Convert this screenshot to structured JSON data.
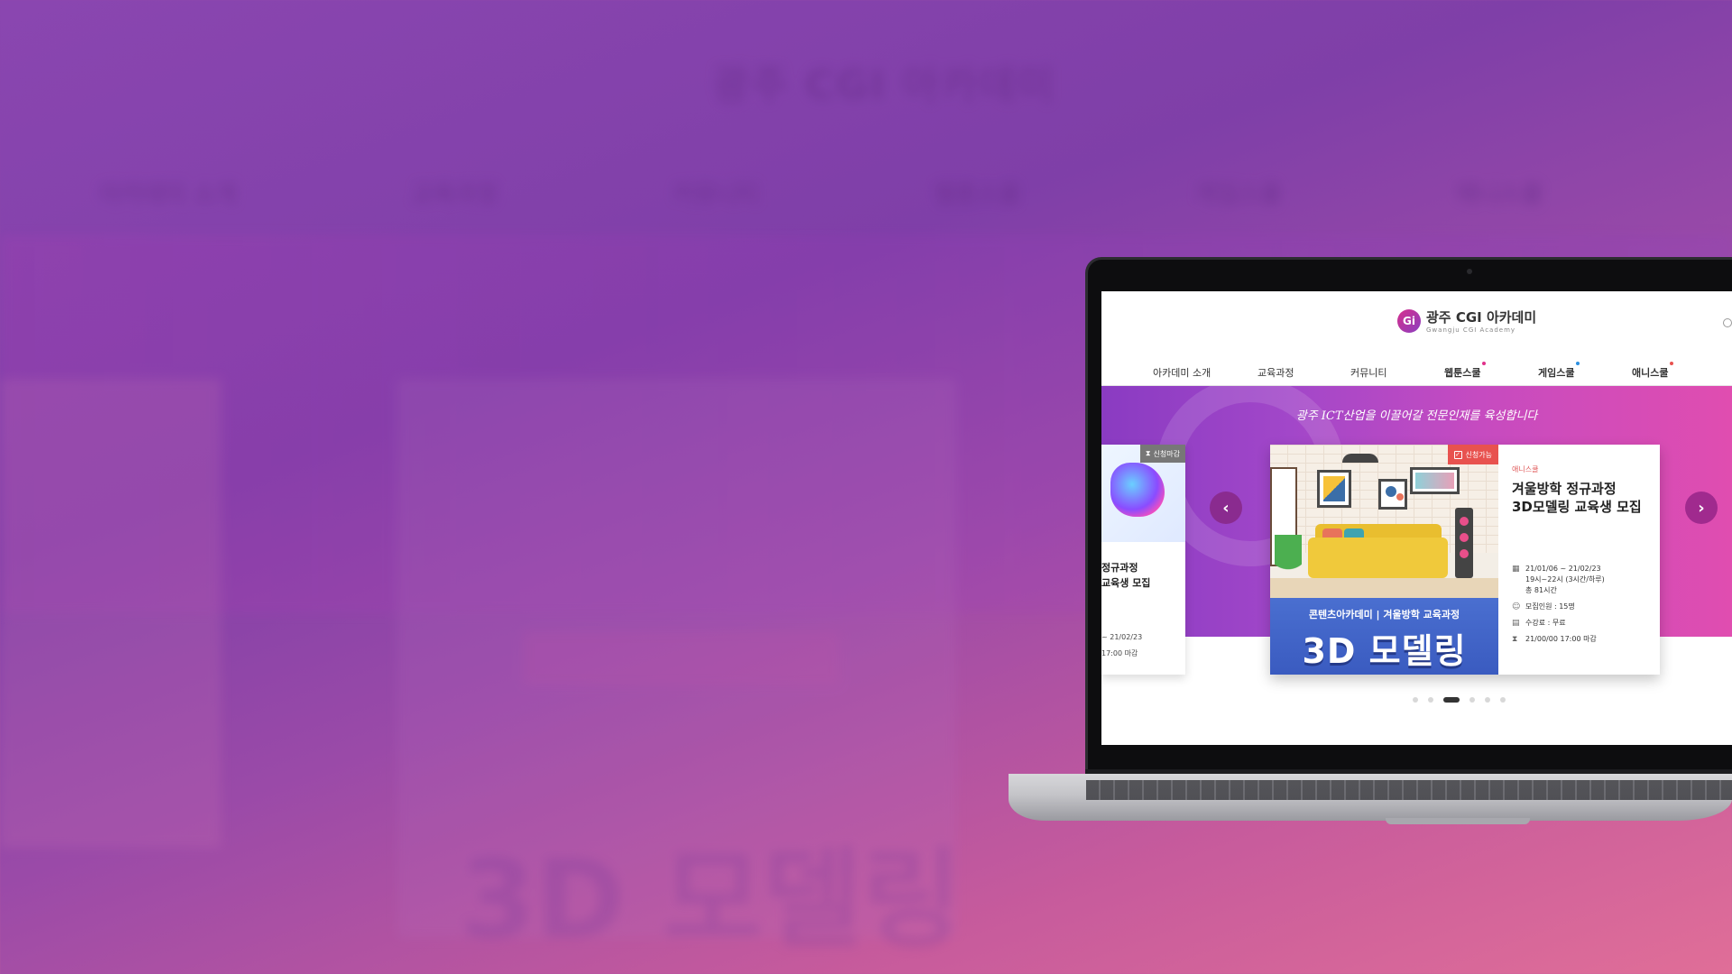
{
  "background": {
    "logo_text": "광주 CGI 아카데미",
    "nav_items": [
      "아카데미 소개",
      "교육과정",
      "커뮤니티",
      "웹툰스쿨",
      "게임스쿨",
      "애니스쿨"
    ],
    "big_text": "3D 모델링"
  },
  "site": {
    "logo_mark": "Gi",
    "logo_title": "광주 CGI 아카데미",
    "logo_sub": "Gwangju CGI Academy",
    "nav": [
      {
        "label": "아카데미 소개",
        "dot": null
      },
      {
        "label": "교육과정",
        "dot": null
      },
      {
        "label": "커뮤니티",
        "dot": null
      },
      {
        "label": "웹툰스쿨",
        "dot": "#e0308a"
      },
      {
        "label": "게임스쿨",
        "dot": "#2b8fe0"
      },
      {
        "label": "애니스쿨",
        "dot": "#e8524f"
      }
    ],
    "tagline": "광주 ICT산업을 이끌어갈 전문인재를 육성합니다"
  },
  "card_left": {
    "badge": "신청마감",
    "title_line1": "정규과정",
    "title_line2": "교육생 모집",
    "meta_line1": "~ 21/02/23",
    "meta_line2": "17:00 마감"
  },
  "card_main": {
    "badge": "신청가능",
    "banner_top": "콘텐츠아카데미 | 겨울방학 교육과정",
    "banner_big": "3D 모델링",
    "category": "애니스쿨",
    "title_line1": "겨울방학 정규과정",
    "title_line2": "3D모델링 교육생 모집",
    "rows": [
      {
        "icon": "calendar-icon",
        "lines": [
          "21/01/06 ~ 21/02/23",
          "19시~22시 (3시간/하루)",
          "총 81시간"
        ]
      },
      {
        "icon": "person-icon",
        "lines": [
          "모집인원 : 15명"
        ]
      },
      {
        "icon": "fee-icon",
        "lines": [
          "수강료 : 무료"
        ]
      },
      {
        "icon": "hourglass-icon",
        "lines": [
          "21/00/00 17:00 마감"
        ]
      }
    ]
  },
  "carousel": {
    "prev_glyph": "‹",
    "next_glyph": "›",
    "dot_count": 6,
    "active_dot": 3
  },
  "colors": {
    "accent": "#a247c9",
    "brand_pink": "#e0308a",
    "badge_available": "#e8524f",
    "badge_closed": "#777777",
    "banner_blue": "#4a6fd0"
  }
}
